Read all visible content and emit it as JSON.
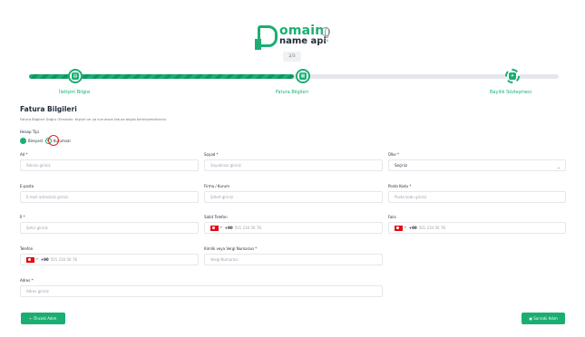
{
  "brand": {
    "top": "omain",
    "bottom": "name api",
    "partner": "ICANN"
  },
  "step_counter": "2/3",
  "progress": {
    "completed_fraction": 0.5
  },
  "steps": [
    {
      "label": "İletişim Bilgisi",
      "icon": "contact-card-icon"
    },
    {
      "label": "Fatura Bilgileri",
      "icon": "invoice-icon"
    },
    {
      "label": "Bayilik Sözleşmesi",
      "icon": "handshake-icon"
    }
  ],
  "section": {
    "title": "Fatura Bilgileri",
    "description": "Fatura Bilgileri Doğru Olmalıdır. Kişisel ve ya kurumsal fatura bilgisi belirleyebilirsiniz."
  },
  "account_type": {
    "label": "Hesap Tipi",
    "options": [
      "Bireysel",
      "Kurumsal"
    ],
    "selected": "Kurumsal"
  },
  "fields": {
    "first_name": {
      "label": "Ad *",
      "placeholder": "Adınızı giriniz"
    },
    "last_name": {
      "label": "Soyad *",
      "placeholder": "Soyadınızı giriniz"
    },
    "country": {
      "label": "Ülke *",
      "value": "Seçiniz"
    },
    "email": {
      "label": "E-posta",
      "placeholder": "E-mail adresinizi giriniz"
    },
    "company": {
      "label": "Firma / Kurum",
      "placeholder": "Şirket giriniz"
    },
    "postal_code": {
      "label": "Posta Kodu *",
      "placeholder": "Posta kodu giriniz"
    },
    "city": {
      "label": "İl *",
      "placeholder": "Şehir giriniz"
    },
    "landline": {
      "label": "Sabit Telefon",
      "code": "+90",
      "placeholder": "501 234 56 78"
    },
    "fax": {
      "label": "Faks",
      "code": "+90",
      "placeholder": "501 234 56 78"
    },
    "phone": {
      "label": "Telefon",
      "code": "+90",
      "placeholder": "501 234 56 78"
    },
    "tax_id": {
      "label": "Kimlik veya Vergi Numarası *",
      "placeholder": "Vergi Numarası"
    },
    "address": {
      "label": "Adres *",
      "placeholder": "Adres giriniz"
    }
  },
  "buttons": {
    "prev": "←  Önceki Adım",
    "next": "Sonraki Adım"
  },
  "colors": {
    "accent": "#1aae73",
    "focus": "#e02424"
  }
}
